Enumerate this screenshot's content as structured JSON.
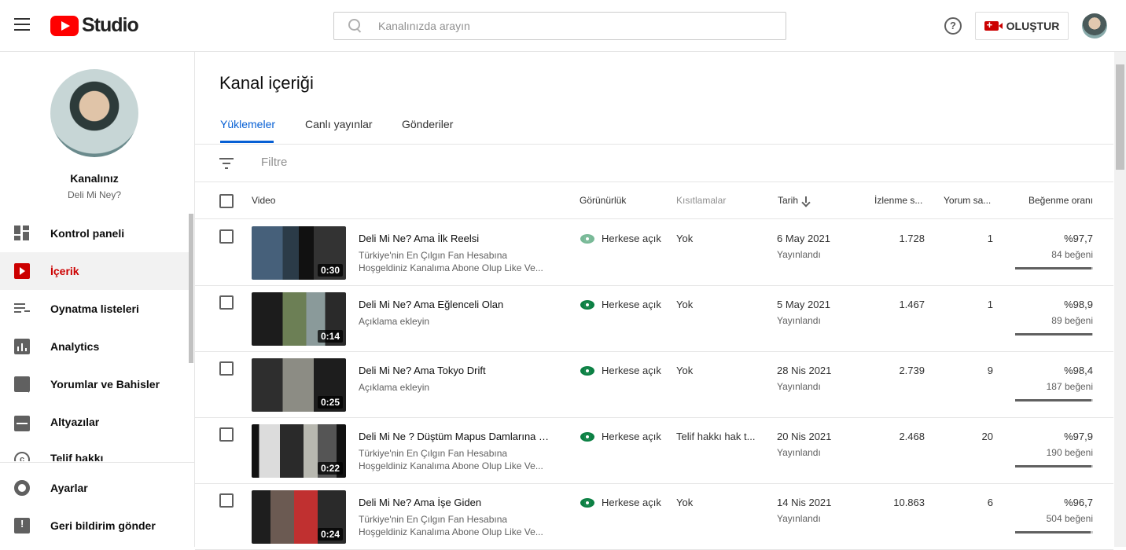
{
  "header": {
    "logo_text": "Studio",
    "search_placeholder": "Kanalınızda arayın",
    "help_icon": "?",
    "create_label": "OLUŞTUR"
  },
  "sidebar": {
    "channel_title": "Kanalınız",
    "channel_name": "Deli Mi Ney?",
    "items": [
      {
        "label": "Kontrol paneli",
        "icon": "dashboard-icon"
      },
      {
        "label": "İçerik",
        "icon": "content-icon"
      },
      {
        "label": "Oynatma listeleri",
        "icon": "playlist-icon"
      },
      {
        "label": "Analytics",
        "icon": "analytics-icon"
      },
      {
        "label": "Yorumlar ve Bahisler",
        "icon": "comments-icon"
      },
      {
        "label": "Altyazılar",
        "icon": "subtitles-icon"
      },
      {
        "label": "Telif hakkı",
        "icon": "copyright-icon"
      }
    ],
    "bottom_items": [
      {
        "label": "Ayarlar",
        "icon": "gear-icon"
      },
      {
        "label": "Geri bildirim gönder",
        "icon": "feedback-icon"
      }
    ]
  },
  "main": {
    "title": "Kanal içeriği",
    "tabs": [
      "Yüklemeler",
      "Canlı yayınlar",
      "Gönderiler"
    ],
    "filter_placeholder": "Filtre",
    "columns": {
      "video": "Video",
      "visibility": "Görünürlük",
      "restrictions": "Kısıtlamalar",
      "date": "Tarih",
      "views": "İzlenme s...",
      "comments": "Yorum sa...",
      "likes": "Beğenme oranı"
    },
    "rows": [
      {
        "duration": "0:30",
        "title": "Deli Mi Ne? Ama İlk Reelsi",
        "desc1": "Türkiye'nin En Çılgın Fan Hesabına",
        "desc2": "Hoşgeldiniz Kanalıma Abone Olup Like Ve...",
        "visibility": "Herkese açık",
        "restriction": "Yok",
        "date": "6 May 2021",
        "status": "Yayınlandı",
        "views": "1.728",
        "comments": "1",
        "like_ratio": "%97,7",
        "like_count": "84 beğeni",
        "like_fraction": 0.977
      },
      {
        "duration": "0:14",
        "title": "Deli Mi Ne? Ama Eğlenceli Olan",
        "desc1": "Açıklama ekleyin",
        "desc2": "",
        "visibility": "Herkese açık",
        "restriction": "Yok",
        "date": "5 May 2021",
        "status": "Yayınlandı",
        "views": "1.467",
        "comments": "1",
        "like_ratio": "%98,9",
        "like_count": "89 beğeni",
        "like_fraction": 0.989
      },
      {
        "duration": "0:25",
        "title": "Deli Mi Ne? Ama Tokyo Drift",
        "desc1": "Açıklama ekleyin",
        "desc2": "",
        "visibility": "Herkese açık",
        "restriction": "Yok",
        "date": "28 Nis 2021",
        "status": "Yayınlandı",
        "views": "2.739",
        "comments": "9",
        "like_ratio": "%98,4",
        "like_count": "187 beğeni",
        "like_fraction": 0.984
      },
      {
        "duration": "0:22",
        "title": "Deli Mi Ne ? Düştüm Mapus Damlarına ! ...",
        "desc1": "Türkiye'nin En Çılgın Fan Hesabına",
        "desc2": "Hoşgeldiniz Kanalıma Abone Olup Like Ve...",
        "visibility": "Herkese açık",
        "restriction": "Telif hakkı hak t...",
        "date": "20 Nis 2021",
        "status": "Yayınlandı",
        "views": "2.468",
        "comments": "20",
        "like_ratio": "%97,9",
        "like_count": "190 beğeni",
        "like_fraction": 0.979
      },
      {
        "duration": "0:24",
        "title": "Deli Mi Ne? Ama İşe Giden",
        "desc1": "Türkiye'nin En Çılgın Fan Hesabına",
        "desc2": "Hoşgeldiniz Kanalıma Abone Olup Like Ve...",
        "visibility": "Herkese açık",
        "restriction": "Yok",
        "date": "14 Nis 2021",
        "status": "Yayınlandı",
        "views": "10.863",
        "comments": "6",
        "like_ratio": "%96,7",
        "like_count": "504 beğeni",
        "like_fraction": 0.967
      }
    ]
  },
  "colors": {
    "accent_blue": "#065fd4",
    "brand_red": "#ff0000",
    "visibility_green": "#0b8043"
  }
}
